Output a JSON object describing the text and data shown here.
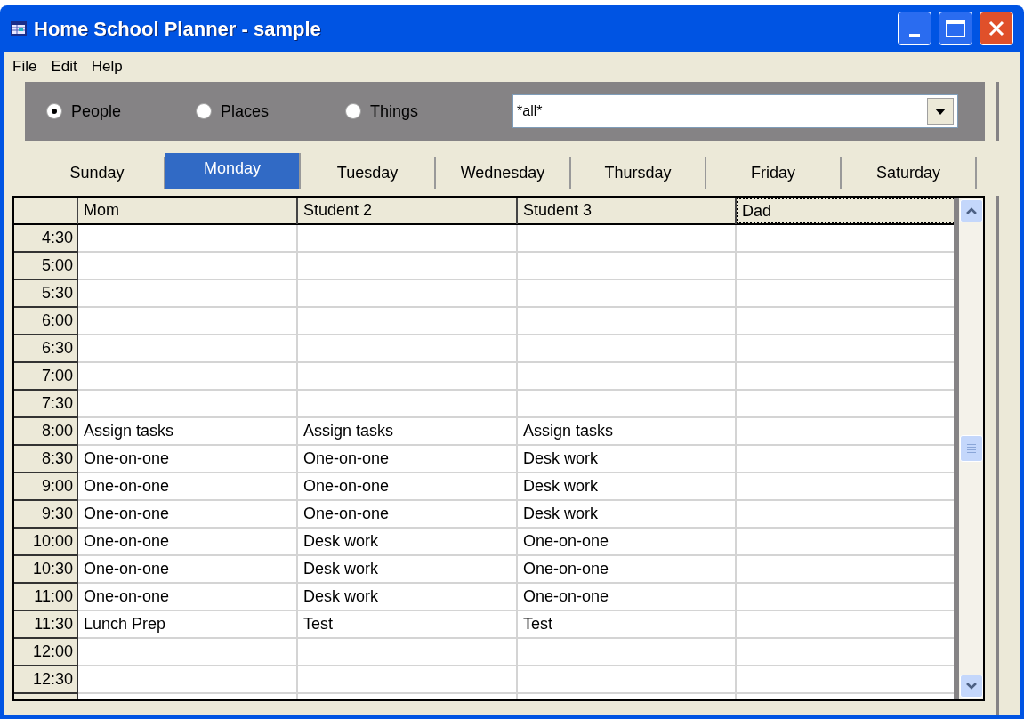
{
  "window": {
    "title": "Home School Planner - sample"
  },
  "menu": [
    "File",
    "Edit",
    "Help"
  ],
  "filter": {
    "options": [
      {
        "label": "People",
        "selected": true
      },
      {
        "label": "Places",
        "selected": false
      },
      {
        "label": "Things",
        "selected": false
      }
    ],
    "dropdown": {
      "value": "*all*"
    }
  },
  "tabs": [
    {
      "label": "Sunday",
      "selected": false
    },
    {
      "label": "Monday",
      "selected": true
    },
    {
      "label": "Tuesday",
      "selected": false
    },
    {
      "label": "Wednesday",
      "selected": false
    },
    {
      "label": "Thursday",
      "selected": false
    },
    {
      "label": "Friday",
      "selected": false
    },
    {
      "label": "Saturday",
      "selected": false
    }
  ],
  "table": {
    "columns": [
      {
        "label": "Mom",
        "focused": false
      },
      {
        "label": "Student 2",
        "focused": false
      },
      {
        "label": "Student 3",
        "focused": false
      },
      {
        "label": "Dad",
        "focused": true
      }
    ],
    "rows": [
      {
        "time": "4:30",
        "cells": [
          "",
          "",
          "",
          ""
        ]
      },
      {
        "time": "5:00",
        "cells": [
          "",
          "",
          "",
          ""
        ]
      },
      {
        "time": "5:30",
        "cells": [
          "",
          "",
          "",
          ""
        ]
      },
      {
        "time": "6:00",
        "cells": [
          "",
          "",
          "",
          ""
        ]
      },
      {
        "time": "6:30",
        "cells": [
          "",
          "",
          "",
          ""
        ]
      },
      {
        "time": "7:00",
        "cells": [
          "",
          "",
          "",
          ""
        ]
      },
      {
        "time": "7:30",
        "cells": [
          "",
          "",
          "",
          ""
        ]
      },
      {
        "time": "8:00",
        "cells": [
          "Assign tasks",
          "Assign tasks",
          "Assign tasks",
          ""
        ]
      },
      {
        "time": "8:30",
        "cells": [
          "One-on-one",
          "One-on-one",
          "Desk work",
          ""
        ]
      },
      {
        "time": "9:00",
        "cells": [
          "One-on-one",
          "One-on-one",
          "Desk work",
          ""
        ]
      },
      {
        "time": "9:30",
        "cells": [
          "One-on-one",
          "One-on-one",
          "Desk work",
          ""
        ]
      },
      {
        "time": "10:00",
        "cells": [
          "One-on-one",
          "Desk work",
          "One-on-one",
          ""
        ]
      },
      {
        "time": "10:30",
        "cells": [
          "One-on-one",
          "Desk work",
          "One-on-one",
          ""
        ]
      },
      {
        "time": "11:00",
        "cells": [
          "One-on-one",
          "Desk work",
          "One-on-one",
          ""
        ]
      },
      {
        "time": "11:30",
        "cells": [
          "Lunch Prep",
          "Test",
          "Test",
          ""
        ]
      },
      {
        "time": "12:00",
        "cells": [
          "",
          "",
          "",
          ""
        ]
      },
      {
        "time": "12:30",
        "cells": [
          "",
          "",
          "",
          ""
        ]
      }
    ]
  }
}
